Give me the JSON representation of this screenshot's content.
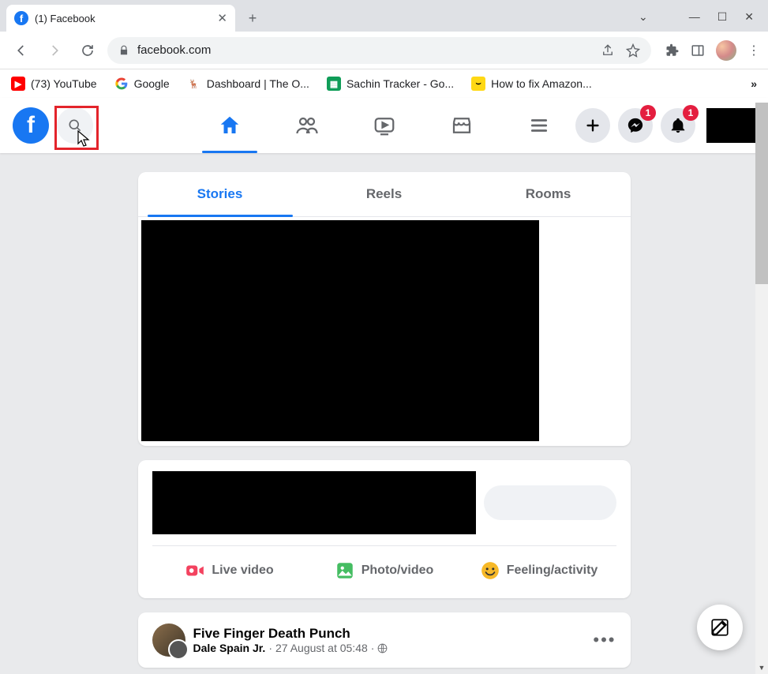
{
  "browser": {
    "tab_title": "(1) Facebook",
    "url": "facebook.com",
    "bookmarks": [
      {
        "label": "(73) YouTube"
      },
      {
        "label": "Google"
      },
      {
        "label": "Dashboard | The O..."
      },
      {
        "label": "Sachin Tracker - Go..."
      },
      {
        "label": "How to fix Amazon..."
      }
    ]
  },
  "fb_nav": {
    "messenger_badge": "1",
    "notifications_badge": "1"
  },
  "stories": {
    "tabs": [
      "Stories",
      "Reels",
      "Rooms"
    ]
  },
  "composer": {
    "actions": [
      {
        "label": "Live video"
      },
      {
        "label": "Photo/video"
      },
      {
        "label": "Feeling/activity"
      }
    ]
  },
  "post": {
    "title": "Five Finger Death Punch",
    "author": "Dale Spain Jr.",
    "time": "27 August at 05:48"
  }
}
